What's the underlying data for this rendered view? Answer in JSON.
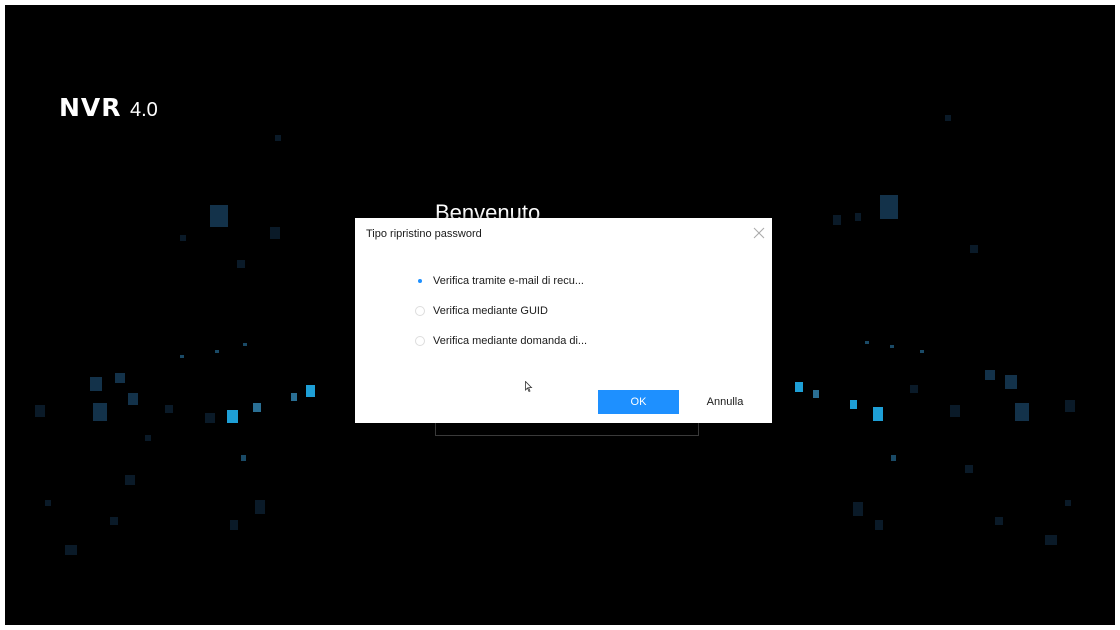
{
  "brand": {
    "logo_main": "NVR",
    "logo_version": "4.0"
  },
  "login": {
    "welcome": "Benvenuto"
  },
  "dialog": {
    "title": "Tipo ripristino password",
    "options": [
      {
        "label": "Verifica tramite e-mail di recu...",
        "selected": true
      },
      {
        "label": "Verifica mediante GUID",
        "selected": false
      },
      {
        "label": "Verifica mediante domanda di...",
        "selected": false
      }
    ],
    "ok_label": "OK",
    "cancel_label": "Annulla"
  },
  "colors": {
    "background": "#000000",
    "accent": "#1e90ff",
    "dialog_bg": "#ffffff"
  },
  "icons": {
    "close": "close-icon",
    "cursor": "mouse-pointer-icon"
  }
}
